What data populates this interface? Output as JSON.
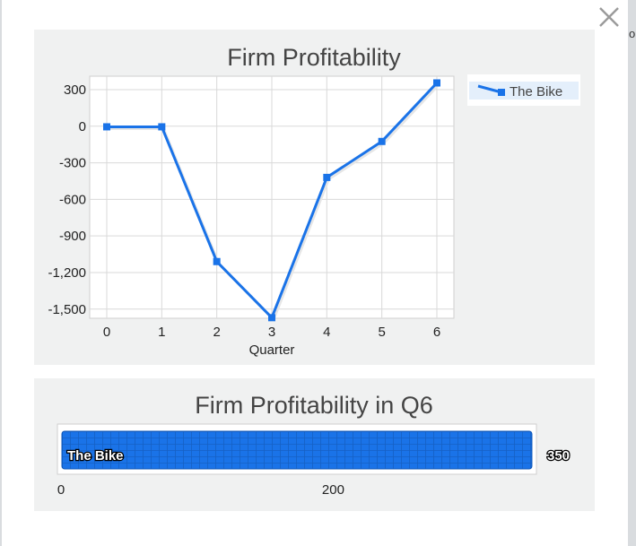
{
  "background": {
    "partial_text": "or"
  },
  "modal": {
    "close_icon": "close-icon"
  },
  "chart_data": [
    {
      "type": "line",
      "title": "Firm Profitability",
      "xlabel": "Quarter",
      "ylabel": "",
      "x": [
        0,
        1,
        2,
        3,
        4,
        5,
        6
      ],
      "x_tick_labels": [
        "0",
        "1",
        "2",
        "3",
        "4",
        "5",
        "6"
      ],
      "y_tick_labels": [
        "300",
        "0",
        "-300",
        "-600",
        "-900",
        "-1,200",
        "-1,500"
      ],
      "y_ticks": [
        300,
        0,
        -300,
        -600,
        -900,
        -1200,
        -1500
      ],
      "ylim": [
        -1575,
        410
      ],
      "grid": true,
      "legend": "right",
      "series": [
        {
          "name": "The Bike",
          "color": "#1a73e8",
          "values": [
            -5,
            -5,
            -1110,
            -1570,
            -420,
            -125,
            355
          ]
        }
      ]
    },
    {
      "type": "bar",
      "orientation": "horizontal",
      "title": "Firm Profitability in Q6",
      "categories": [
        "The Bike"
      ],
      "values": [
        350
      ],
      "value_labels": [
        "350"
      ],
      "xlim": [
        0,
        352
      ],
      "x_ticks": [
        0,
        200
      ],
      "x_tick_labels": [
        "0",
        "200"
      ],
      "color": "#1a73e8"
    }
  ]
}
